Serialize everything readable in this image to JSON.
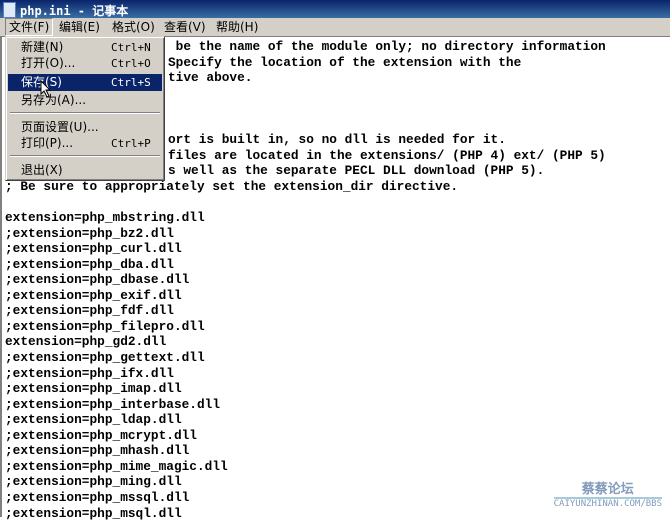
{
  "window": {
    "title": "php.ini - 记事本"
  },
  "menubar": [
    {
      "label": "文件(F)"
    },
    {
      "label": "编辑(E)"
    },
    {
      "label": "格式(O)"
    },
    {
      "label": "查看(V)"
    },
    {
      "label": "帮助(H)"
    }
  ],
  "file_menu": {
    "items": [
      {
        "label": "新建(N)",
        "shortcut": "Ctrl+N"
      },
      {
        "label": "打开(O)...",
        "shortcut": "Ctrl+O"
      },
      {
        "label": "保存(S)",
        "shortcut": "Ctrl+S",
        "highlighted": true
      },
      {
        "label": "另存为(A)...",
        "shortcut": ""
      },
      {
        "label": "页面设置(U)...",
        "shortcut": ""
      },
      {
        "label": "打印(P)...",
        "shortcut": "Ctrl+P"
      },
      {
        "label": "退出(X)",
        "shortcut": ""
      }
    ]
  },
  "editor": {
    "partial_lines": [
      " be the name of the module only; no directory information",
      "Specify the location of the extension with the",
      "tive above.",
      "ort is built in, so no dll is needed for it.",
      "files are located in the extensions/ (PHP 4) ext/ (PHP 5)",
      "s well as the separate PECL DLL download (PHP 5)."
    ],
    "lines": [
      "; Be sure to appropriately set the extension_dir directive.",
      "",
      "extension=php_mbstring.dll",
      ";extension=php_bz2.dll",
      ";extension=php_curl.dll",
      ";extension=php_dba.dll",
      ";extension=php_dbase.dll",
      ";extension=php_exif.dll",
      ";extension=php_fdf.dll",
      ";extension=php_filepro.dll",
      "extension=php_gd2.dll",
      ";extension=php_gettext.dll",
      ";extension=php_ifx.dll",
      ";extension=php_imap.dll",
      ";extension=php_interbase.dll",
      ";extension=php_ldap.dll",
      ";extension=php_mcrypt.dll",
      ";extension=php_mhash.dll",
      ";extension=php_mime_magic.dll",
      ";extension=php_ming.dll",
      ";extension=php_mssql.dll",
      ";extension=php_msql.dll"
    ]
  },
  "watermark": {
    "logo": "蔡蔡论坛",
    "url": "CAIYUNZHINAN.COM/BBS"
  }
}
